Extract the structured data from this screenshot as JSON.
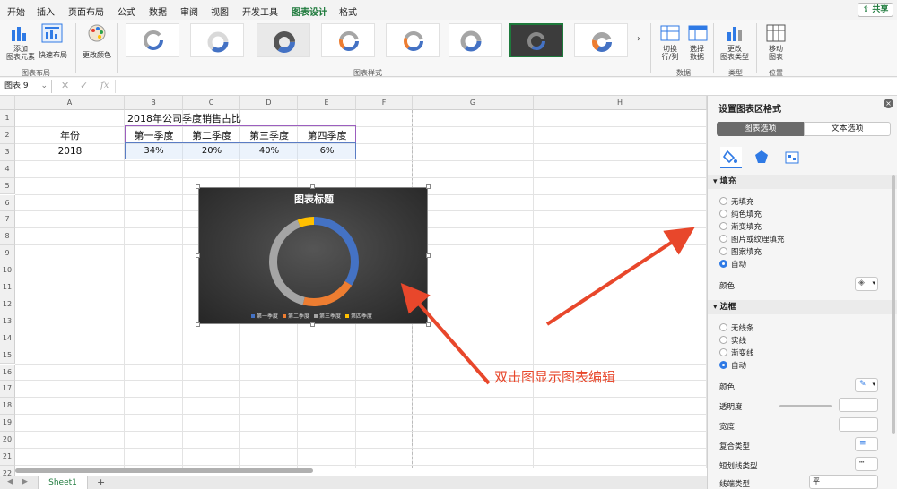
{
  "menu": [
    "开始",
    "插入",
    "页面布局",
    "公式",
    "数据",
    "审阅",
    "视图",
    "开发工具",
    "图表设计",
    "格式"
  ],
  "share_label": "共享",
  "ribbon": {
    "add_element": "添加\n图表元素",
    "quick_layout": "快速布局",
    "change_colors": "更改颜色",
    "switch_row_col": "切换\n行/列",
    "select_data": "选择\n数据",
    "change_type": "更改\n图表类型",
    "move_chart": "移动\n图表",
    "groups": {
      "layout": "图表布局",
      "styles": "图表样式",
      "data": "数据",
      "type": "类型",
      "location": "位置"
    }
  },
  "formula_bar": {
    "name_box": "图表 9",
    "fx": "fx"
  },
  "columns": [
    "A",
    "B",
    "C",
    "D",
    "E",
    "F",
    "G",
    "H"
  ],
  "rows": [
    "1",
    "2",
    "3",
    "4",
    "5",
    "6",
    "7",
    "8",
    "9",
    "10",
    "11",
    "12",
    "13",
    "14",
    "15",
    "16",
    "17",
    "18",
    "19",
    "20",
    "21",
    "22"
  ],
  "sheet": {
    "title": "2018年公司季度销售占比",
    "row_header_label": "年份",
    "year": "2018",
    "headers": [
      "第一季度",
      "第二季度",
      "第三季度",
      "第四季度"
    ],
    "values": [
      "34%",
      "20%",
      "40%",
      "6%"
    ]
  },
  "chart_data": {
    "type": "pie",
    "title": "图表标题",
    "categories": [
      "第一季度",
      "第二季度",
      "第三季度",
      "第四季度"
    ],
    "values": [
      34,
      20,
      40,
      6
    ],
    "colors": [
      "#4472c4",
      "#ed7d31",
      "#a5a5a5",
      "#ffc000"
    ],
    "legend": "bottom",
    "hole": true
  },
  "annotation": "双击图显示图表编辑",
  "sheet_tab": "Sheet1",
  "pane": {
    "title": "设置图表区格式",
    "tabs": [
      "图表选项",
      "文本选项"
    ],
    "fill_section": "填充",
    "fill_options": [
      "无填充",
      "纯色填充",
      "渐变填充",
      "图片或纹理填充",
      "图案填充",
      "自动"
    ],
    "color_label": "颜色",
    "border_section": "边框",
    "border_options": [
      "无线条",
      "实线",
      "渐变线",
      "自动"
    ],
    "border_color": "颜色",
    "transparency": "透明度",
    "width": "宽度",
    "compound": "复合类型",
    "dash": "短划线类型",
    "cap": "线端类型",
    "cap_value": "平"
  }
}
